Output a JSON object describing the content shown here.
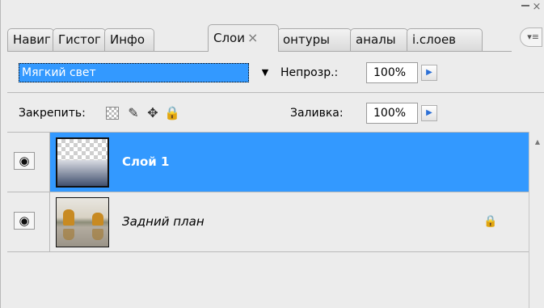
{
  "window": {
    "close_glyph": "×",
    "menu_glyph": "▾≡"
  },
  "tabs": [
    {
      "label": "Навиг"
    },
    {
      "label": "Гистог"
    },
    {
      "label": "Инфо"
    },
    {
      "label": "Слои",
      "active": true,
      "close_glyph": "×"
    },
    {
      "label": "онтуры"
    },
    {
      "label": "аналы"
    },
    {
      "label": "і.слоев"
    }
  ],
  "blend": {
    "mode_value": "Мягкий свет",
    "opacity_label": "Непрозр.:",
    "opacity_value": "100%"
  },
  "lock": {
    "label": "Закрепить:",
    "icons": [
      "transparency-lock-icon",
      "brush-icon",
      "move-icon",
      "padlock-icon"
    ],
    "fill_label": "Заливка:",
    "fill_value": "100%"
  },
  "layers": [
    {
      "name": "Слой 1",
      "selected": true,
      "visible": true,
      "locked": false
    },
    {
      "name": "Задний план",
      "selected": false,
      "visible": true,
      "locked": true
    }
  ],
  "colors": {
    "selection": "#3399ff",
    "panel_bg": "#ececec"
  }
}
